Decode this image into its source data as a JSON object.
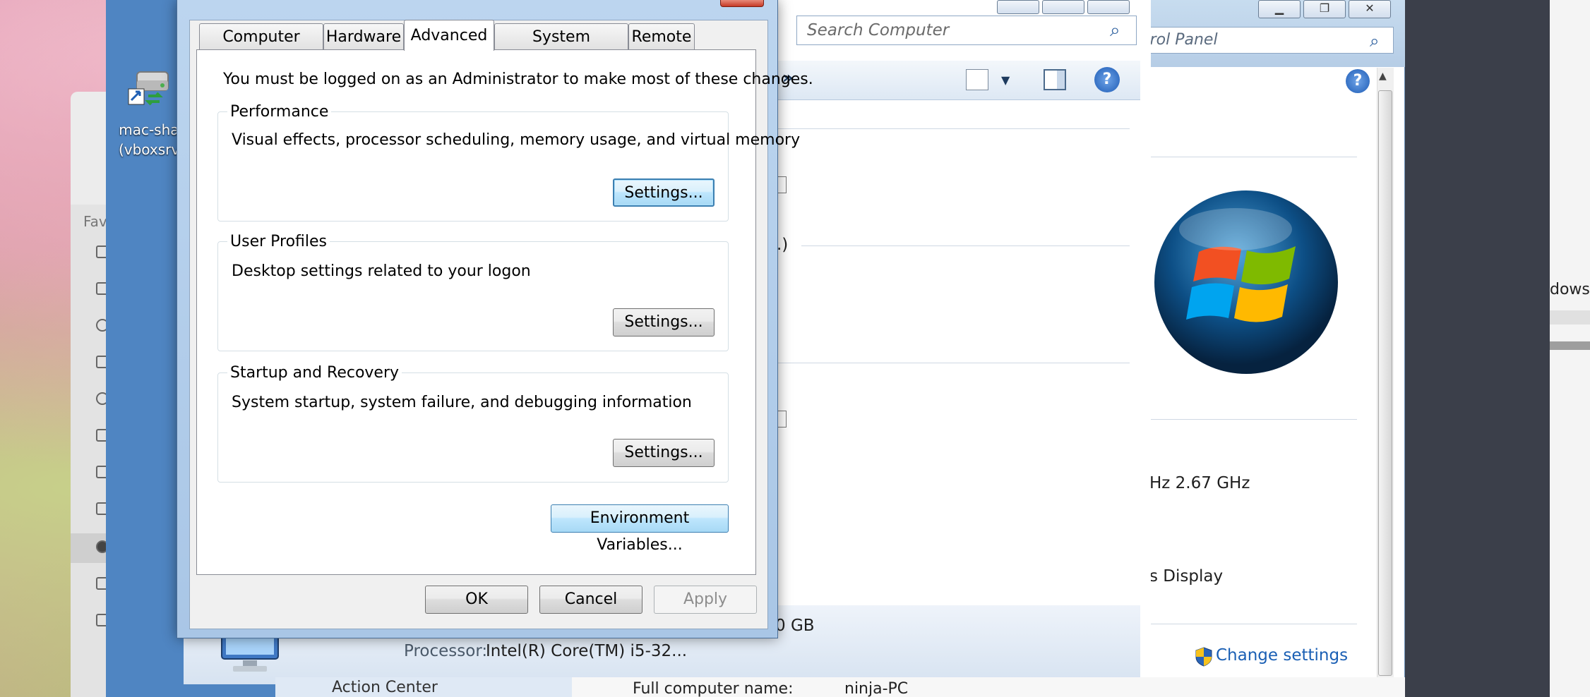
{
  "desktop": {
    "icon_label_line1": "mac-shar",
    "icon_label_line2": "(vboxsrv)",
    "right_app_text": "dows"
  },
  "finder": {
    "favorites_label": "Fav"
  },
  "computer_window": {
    "search_placeholder": "Search Computer",
    "overflow_chevron": "»",
    "memory_fragment": "0 GB"
  },
  "control_panel": {
    "search_placeholder": "trol Panel",
    "cpu_speed": "Hz   2.67 GHz",
    "display_fragment": "s Display",
    "change_settings": "Change settings"
  },
  "system_info": {
    "processor_label": "Processor:",
    "processor_value": "Intel(R) Core(TM) i5-32...",
    "action_center": "Action Center",
    "full_computer_name_label": "Full computer name:",
    "full_computer_name_value": "ninja-PC"
  },
  "dialog": {
    "tabs": [
      {
        "label": "Computer Name"
      },
      {
        "label": "Hardware"
      },
      {
        "label": "Advanced"
      },
      {
        "label": "System Protection"
      },
      {
        "label": "Remote"
      }
    ],
    "admin_note": "You must be logged on as an Administrator to make most of these changes.",
    "performance": {
      "title": "Performance",
      "description": "Visual effects, processor scheduling, memory usage, and virtual memory",
      "button": "Settings..."
    },
    "user_profiles": {
      "title": "User Profiles",
      "description": "Desktop settings related to your logon",
      "button": "Settings..."
    },
    "startup_recovery": {
      "title": "Startup and Recovery",
      "description": "System startup, system failure, and debugging information",
      "button": "Settings..."
    },
    "env_vars_button": "Environment Variables...",
    "ok_button": "OK",
    "cancel_button": "Cancel",
    "apply_button": "Apply"
  },
  "colors": {
    "accent": "#3c7fb1",
    "link": "#1a5fb4",
    "frame": "#a9c6e6"
  }
}
